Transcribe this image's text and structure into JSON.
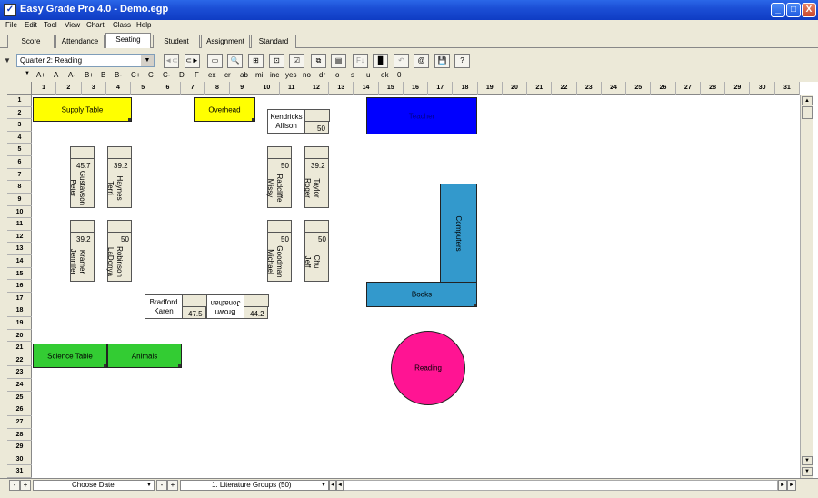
{
  "window": {
    "title": "Easy Grade Pro 4.0 - Demo.egp",
    "minimize": "_",
    "maximize": "□",
    "close": "X"
  },
  "menu": [
    "File",
    "Edit",
    "Tool",
    "View",
    "Chart",
    "Class",
    "Help"
  ],
  "tabs": [
    "Score",
    "Attendance",
    "Seating",
    "Student",
    "Assignment",
    "Standard"
  ],
  "active_tab": "Seating",
  "toolbar": {
    "quarter_value": "Quarter 2: Reading",
    "tools": [
      "◄⊂",
      "⊂►",
      "▭",
      "🔍",
      "⊞",
      "⊡",
      "☑",
      "⧉",
      "▤",
      "F↓",
      "▐▌",
      "↶",
      "@",
      "💾",
      "?"
    ]
  },
  "grades": [
    "A+",
    "A",
    "A-",
    "B+",
    "B",
    "B-",
    "C+",
    "C",
    "C-",
    "D",
    "F",
    "ex",
    "cr",
    "ab",
    "mi",
    "inc",
    "yes",
    "no",
    "dr",
    "o",
    "s",
    "u",
    "ok",
    "0"
  ],
  "columns": [
    "1",
    "2",
    "3",
    "4",
    "5",
    "6",
    "7",
    "8",
    "9",
    "10",
    "11",
    "12",
    "13",
    "14",
    "15",
    "16",
    "17",
    "18",
    "19",
    "20",
    "21",
    "22",
    "23",
    "24",
    "25",
    "26",
    "27",
    "28",
    "29",
    "30",
    "31"
  ],
  "rows": [
    "1",
    "2",
    "3",
    "4",
    "5",
    "6",
    "7",
    "8",
    "9",
    "10",
    "11",
    "12",
    "13",
    "14",
    "15",
    "16",
    "17",
    "18",
    "19",
    "20",
    "21",
    "22",
    "23",
    "24",
    "25",
    "26",
    "27",
    "28",
    "29",
    "30",
    "31"
  ],
  "objects": {
    "supply_table": {
      "label": "Supply Table",
      "color": "#ffff00"
    },
    "overhead": {
      "label": "Overhead",
      "color": "#ffff00"
    },
    "teacher": {
      "label": "Teacher",
      "color": "#0000ff"
    },
    "computers": {
      "label": "Computers",
      "color": "#3399cc"
    },
    "books": {
      "label": "Books",
      "color": "#3399cc"
    },
    "science_table": {
      "label": "Science Table",
      "color": "#33cc33"
    },
    "animals": {
      "label": "Animals",
      "color": "#33cc33"
    },
    "reading": {
      "label": "Reading",
      "color": "#ff1493"
    }
  },
  "students": {
    "kendricks": {
      "first": "Kendricks",
      "last": "Allison",
      "score": "50"
    },
    "gustavson": {
      "first": "Gustavson",
      "last": "Peter",
      "score": "45.7"
    },
    "haynes": {
      "first": "Haynes",
      "last": "Terri",
      "score": "39.2"
    },
    "radcliffe": {
      "first": "Radcliffe",
      "last": "Missy",
      "score": "50"
    },
    "taylor": {
      "first": "Taylor",
      "last": "Roger",
      "score": "39.2"
    },
    "kramer": {
      "first": "Kramer",
      "last": "Jennifer",
      "score": "39.2"
    },
    "robinson": {
      "first": "Robinson",
      "last": "LaDonya",
      "score": "50"
    },
    "goodman": {
      "first": "Goodman",
      "last": "Michael",
      "score": "50"
    },
    "chu": {
      "first": "Chu",
      "last": "Jeff",
      "score": "50"
    },
    "bradford": {
      "first": "Bradford",
      "last": "Karen",
      "score": "47.5"
    },
    "brown": {
      "first": "Brown",
      "last": "Jonathan",
      "score": "44.2"
    }
  },
  "bottom": {
    "minus": "-",
    "plus": "+",
    "date_select": "Choose Date",
    "group_select": "1. Literature Groups (50)",
    "nav_first": "◄",
    "nav_prev": "◄",
    "nav_next": "►",
    "nav_last": "►"
  }
}
